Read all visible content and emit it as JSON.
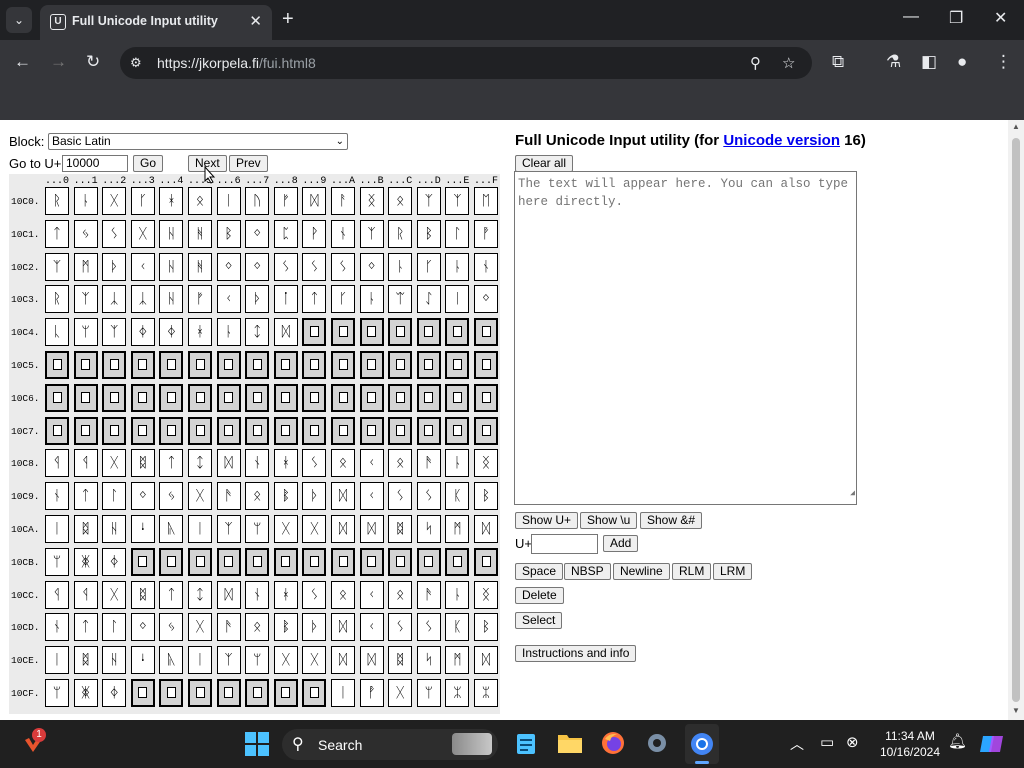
{
  "browser": {
    "tab_title": "Full Unicode Input utility",
    "tab_favicon": "U",
    "url_host": "https://jkorpela.fi",
    "url_path": "/fui.html8",
    "colors": {
      "frame": "#202124",
      "toolbar": "#35363a"
    }
  },
  "page": {
    "block_label": "Block:",
    "block_selected": "Basic Latin",
    "goto_label": "Go to U+",
    "goto_value": "10000",
    "go_button": "Go",
    "next_button": "Next",
    "prev_button": "Prev",
    "title_prefix": "Full Unicode Input utility (for ",
    "title_link": "Unicode version",
    "title_suffix": " 16)",
    "clear_all": "Clear all",
    "textarea_placeholder": "The text will appear here. You can also type here directly.",
    "show_uplus": "Show U+",
    "show_u": "Show \\u",
    "show_amp": "Show &#",
    "uplus_label": "U+",
    "add_button": "Add",
    "space_button": "Space",
    "nbsp_button": "NBSP",
    "newline_button": "Newline",
    "rlm_button": "RLM",
    "lrm_button": "LRM",
    "delete_button": "Delete",
    "select_button": "Select",
    "instructions_button": "Instructions and info"
  },
  "grid": {
    "column_headers": [
      "...0",
      "...1",
      "...2",
      "...3",
      "...4",
      "...5",
      "...6",
      "...7",
      "...8",
      "...9",
      "...A",
      "...B",
      "...C",
      "...D",
      "...E",
      "...F"
    ],
    "missing_glyph": "▯",
    "rows": [
      {
        "label": "10C0.",
        "chars": [
          "ᚱ",
          "ᚿ",
          "ᚷ",
          "ᚴ",
          "ᚼ",
          "ᛟ",
          "ᛁ",
          "ᚢ",
          "ᚠ",
          "ᛞ",
          "ᚨ",
          "ᛝ",
          "ᛟ",
          "ᛉ",
          "ᛉ",
          "ᛖ"
        ]
      },
      {
        "label": "10C1.",
        "chars": [
          "ᛏ",
          "ᛃ",
          "ᛊ",
          "ᚷ",
          "ᚺ",
          "ᚻ",
          "ᛒ",
          "ᛜ",
          "ᛈ",
          "ᚹ",
          "ᚾ",
          "ᛉ",
          "ᚱ",
          "ᛒ",
          "ᛚ",
          "ᚡ"
        ]
      },
      {
        "label": "10C2.",
        "chars": [
          "ᛉ",
          "ᛗ",
          "ᚦ",
          "ᚲ",
          "ᚺ",
          "ᚻ",
          "ᛜ",
          "ᛜ",
          "ᛊ",
          "ᛊ",
          "ᛊ",
          "ᛜ",
          "ᚿ",
          "ᚴ",
          "ᚿ",
          "ᚾ"
        ]
      },
      {
        "label": "10C3.",
        "chars": [
          "ᚱ",
          "ᛉ",
          "ᛣ",
          "ᛣ",
          "ᚺ",
          "ᚠ",
          "ᚲ",
          "ᚦ",
          "ᛙ",
          "ᛏ",
          "ᚴ",
          "ᚿ",
          "ᛠ",
          "ᛇ",
          "ᛁ",
          "ᛜ"
        ]
      },
      {
        "label": "10C4.",
        "chars": [
          "ᚳ",
          "ᛘ",
          "ᛉ",
          "ᛄ",
          "ᛄ",
          "ᚼ",
          "ᚿ",
          "ᛨ",
          "ᛞ",
          "",
          "",
          "",
          "",
          "",
          "",
          ""
        ]
      },
      {
        "label": "10C5.",
        "chars": [
          "",
          "",
          "",
          "",
          "",
          "",
          "",
          "",
          "",
          "",
          "",
          "",
          "",
          "",
          "",
          ""
        ]
      },
      {
        "label": "10C6.",
        "chars": [
          "",
          "",
          "",
          "",
          "",
          "",
          "",
          "",
          "",
          "",
          "",
          "",
          "",
          "",
          "",
          ""
        ]
      },
      {
        "label": "10C7.",
        "chars": [
          "",
          "",
          "",
          "",
          "",
          "",
          "",
          "",
          "",
          "",
          "",
          "",
          "",
          "",
          "",
          ""
        ]
      },
      {
        "label": "10C8.",
        "chars": [
          "ᛩ",
          "ᛩ",
          "ᚷ",
          "ᛥ",
          "ᛏ",
          "ᛨ",
          "ᛞ",
          "ᚾ",
          "ᚼ",
          "ᛊ",
          "ᛟ",
          "ᚲ",
          "ᛟ",
          "ᚫ",
          "ᚿ",
          "ᛝ"
        ]
      },
      {
        "label": "10C9.",
        "chars": [
          "ᚾ",
          "ᛏ",
          "ᛚ",
          "ᛜ",
          "ᛃ",
          "ᚷ",
          "ᚫ",
          "ᛟ",
          "ᛔ",
          "ᚦ",
          "ᛞ",
          "ᚲ",
          "ᛊ",
          "ᛊ",
          "ᛕ",
          "ᛒ"
        ]
      },
      {
        "label": "10CA.",
        "chars": [
          "ᛁ",
          "ᛥ",
          "ᚺ",
          "ᛍ",
          "ᚣ",
          "ᛁ",
          "ᛉ",
          "ᛘ",
          "ᚷ",
          "ᚷ",
          "ᛞ",
          "ᛞ",
          "ᛥ",
          "ᛋ",
          "ᛗ",
          "ᛞ"
        ]
      },
      {
        "label": "10CB.",
        "chars": [
          "ᛘ",
          "ᛤ",
          "ᛄ",
          "",
          "",
          "",
          "",
          "",
          "",
          "",
          "",
          "",
          "",
          "",
          "",
          ""
        ]
      },
      {
        "label": "10CC.",
        "chars": [
          "ᛩ",
          "ᛩ",
          "ᚷ",
          "ᛥ",
          "ᛏ",
          "ᛨ",
          "ᛞ",
          "ᚾ",
          "ᚼ",
          "ᛊ",
          "ᛟ",
          "ᚲ",
          "ᛟ",
          "ᚫ",
          "ᚿ",
          "ᛝ"
        ]
      },
      {
        "label": "10CD.",
        "chars": [
          "ᚾ",
          "ᛏ",
          "ᛚ",
          "ᛜ",
          "ᛃ",
          "ᚷ",
          "ᚫ",
          "ᛟ",
          "ᛔ",
          "ᚦ",
          "ᛞ",
          "ᚲ",
          "ᛊ",
          "ᛊ",
          "ᛕ",
          "ᛒ"
        ]
      },
      {
        "label": "10CE.",
        "chars": [
          "ᛁ",
          "ᛥ",
          "ᚺ",
          "ᛍ",
          "ᚣ",
          "ᛁ",
          "ᛉ",
          "ᛘ",
          "ᚷ",
          "ᚷ",
          "ᛞ",
          "ᛞ",
          "ᛥ",
          "ᛋ",
          "ᛗ",
          "ᛞ"
        ]
      },
      {
        "label": "10CF.",
        "chars": [
          "ᛘ",
          "ᛤ",
          "ᛄ",
          "",
          "",
          "",
          "",
          "",
          "",
          "",
          "ᛁ",
          "ᚡ",
          "ᚷ",
          "ᛘ",
          "ᛯ",
          "ᛯ"
        ]
      }
    ]
  },
  "taskbar": {
    "search_label": "Search",
    "time": "11:34 AM",
    "date": "10/16/2024",
    "notification_badge": "1"
  }
}
